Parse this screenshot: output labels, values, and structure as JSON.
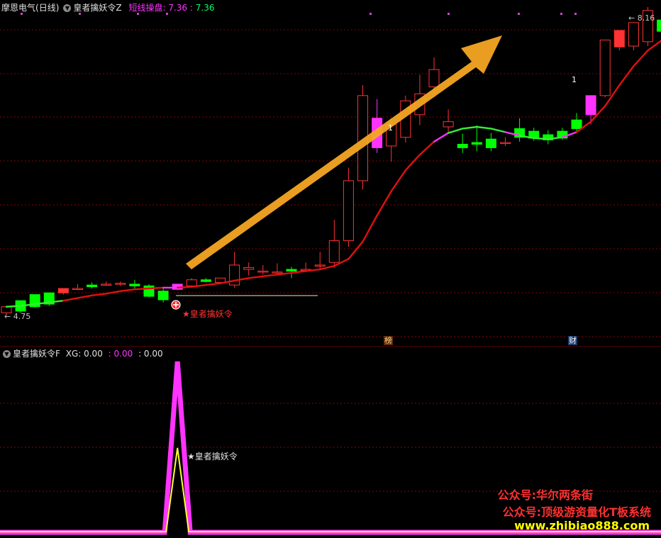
{
  "main_panel": {
    "stock_name": "摩恩电气",
    "period": "(日线)",
    "indicator_name": "皇者擒妖令Z",
    "line_label": "短线操盘",
    "line_value": "7.36",
    "line_value2": "7.36",
    "price_high": "8.16",
    "price_low": "4.75",
    "signal_label": "★皇者擒妖令",
    "badge_list": "榜",
    "badge_fin": "财",
    "candle_number_1": "1",
    "candle_number_2": "1",
    "colors": {
      "up": "#ff3333",
      "down": "#00ff00",
      "grid": "#8b0000",
      "signal": "#ff33ff",
      "line": "#e01010",
      "arrow": "#f5a623"
    }
  },
  "sub_panel": {
    "indicator_name": "皇者擒妖令F",
    "xg_label": "XG: 0.00",
    "val2": ": 0.00",
    "val3": ": 0.00",
    "signal_label": "★皇者擒妖令"
  },
  "watermark": {
    "line1": "公众号:华尔两条街",
    "line2": "公众号:顶级游资量化T板系统",
    "line3": "www.zhibiao888.com"
  },
  "chart_data": {
    "type": "candlestick",
    "y_range": [
      4.75,
      8.16
    ],
    "candles": [
      {
        "o": 4.78,
        "h": 4.85,
        "c": 4.85,
        "l": 4.75
      },
      {
        "o": 4.8,
        "h": 4.92,
        "c": 4.92,
        "l": 4.78
      },
      {
        "o": 4.85,
        "h": 4.99,
        "c": 4.99,
        "l": 4.84
      },
      {
        "o": 4.88,
        "h": 5.01,
        "c": 5.01,
        "l": 4.86
      },
      {
        "o": 5.01,
        "h": 5.06,
        "c": 5.06,
        "l": 4.99
      },
      {
        "o": 5.06,
        "h": 5.11,
        "c": 5.06,
        "l": 5.04
      },
      {
        "o": 5.1,
        "h": 5.13,
        "c": 5.08,
        "l": 5.06
      },
      {
        "o": 5.11,
        "h": 5.14,
        "c": 5.11,
        "l": 5.09
      },
      {
        "o": 5.11,
        "h": 5.14,
        "c": 5.12,
        "l": 5.09
      },
      {
        "o": 5.11,
        "h": 5.16,
        "c": 5.09,
        "l": 5.05
      },
      {
        "o": 5.09,
        "h": 5.11,
        "c": 4.97,
        "l": 4.96
      },
      {
        "o": 5.03,
        "h": 5.06,
        "c": 4.93,
        "l": 4.9
      },
      {
        "o": 5.05,
        "h": 5.11,
        "c": 5.11,
        "l": 5.04
      },
      {
        "o": 5.09,
        "h": 5.18,
        "c": 5.16,
        "l": 5.07
      },
      {
        "o": 5.16,
        "h": 5.18,
        "c": 5.14,
        "l": 5.13
      },
      {
        "o": 5.13,
        "h": 5.18,
        "c": 5.18,
        "l": 5.11
      },
      {
        "o": 5.1,
        "h": 5.48,
        "c": 5.33,
        "l": 5.07
      },
      {
        "o": 5.28,
        "h": 5.36,
        "c": 5.3,
        "l": 5.21
      },
      {
        "o": 5.26,
        "h": 5.33,
        "c": 5.26,
        "l": 5.22
      },
      {
        "o": 5.25,
        "h": 5.35,
        "c": 5.25,
        "l": 5.21
      },
      {
        "o": 5.28,
        "h": 5.31,
        "c": 5.26,
        "l": 5.18
      },
      {
        "o": 5.28,
        "h": 5.36,
        "c": 5.28,
        "l": 5.25
      },
      {
        "o": 5.33,
        "h": 5.48,
        "c": 5.33,
        "l": 5.28
      },
      {
        "o": 5.36,
        "h": 5.85,
        "c": 5.61,
        "l": 5.3
      },
      {
        "o": 5.61,
        "h": 6.45,
        "c": 6.3,
        "l": 5.54
      },
      {
        "o": 6.3,
        "h": 7.4,
        "c": 7.28,
        "l": 6.2
      },
      {
        "o": 7.02,
        "h": 7.24,
        "c": 6.68,
        "l": 6.62
      },
      {
        "o": 6.7,
        "h": 7.02,
        "c": 6.95,
        "l": 6.52
      },
      {
        "o": 6.8,
        "h": 7.28,
        "c": 7.22,
        "l": 6.74
      },
      {
        "o": 7.06,
        "h": 7.52,
        "c": 7.3,
        "l": 6.94
      },
      {
        "o": 7.38,
        "h": 7.72,
        "c": 7.58,
        "l": 7.26
      },
      {
        "o": 6.92,
        "h": 7.12,
        "c": 6.98,
        "l": 6.84
      },
      {
        "o": 6.72,
        "h": 6.84,
        "c": 6.68,
        "l": 6.62
      },
      {
        "o": 6.74,
        "h": 6.94,
        "c": 6.72,
        "l": 6.64
      },
      {
        "o": 6.78,
        "h": 6.85,
        "c": 6.68,
        "l": 6.64
      },
      {
        "o": 6.74,
        "h": 6.8,
        "c": 6.74,
        "l": 6.7
      },
      {
        "o": 6.9,
        "h": 7.02,
        "c": 6.8,
        "l": 6.75
      },
      {
        "o": 6.87,
        "h": 6.91,
        "c": 6.79,
        "l": 6.76
      },
      {
        "o": 6.83,
        "h": 6.88,
        "c": 6.77,
        "l": 6.72
      },
      {
        "o": 6.87,
        "h": 6.91,
        "c": 6.79,
        "l": 6.77
      },
      {
        "o": 7.0,
        "h": 7.08,
        "c": 6.9,
        "l": 6.85
      },
      {
        "o": 7.06,
        "h": 7.28,
        "c": 7.28,
        "l": 6.95
      },
      {
        "o": 7.28,
        "h": 7.92,
        "c": 7.92,
        "l": 7.26
      },
      {
        "o": 7.84,
        "h": 8.03,
        "c": 8.03,
        "l": 7.8
      },
      {
        "o": 7.85,
        "h": 8.12,
        "c": 8.12,
        "l": 7.8
      },
      {
        "o": 7.9,
        "h": 8.3,
        "c": 8.26,
        "l": 7.85
      },
      {
        "o": 8.15,
        "h": 8.5,
        "c": 8.02,
        "l": 7.96
      },
      {
        "o": 8.08,
        "h": 8.14,
        "c": 7.98,
        "l": 7.92
      },
      {
        "o": 8.05,
        "h": 8.18,
        "c": 8.0,
        "l": 7.95
      }
    ],
    "ma": [
      4.85,
      4.86,
      4.88,
      4.9,
      4.92,
      4.95,
      4.98,
      5.0,
      5.03,
      5.05,
      5.06,
      5.07,
      5.07,
      5.08,
      5.1,
      5.12,
      5.15,
      5.18,
      5.2,
      5.22,
      5.24,
      5.26,
      5.28,
      5.32,
      5.4,
      5.6,
      5.9,
      6.18,
      6.42,
      6.6,
      6.75,
      6.85,
      6.9,
      6.92,
      6.9,
      6.86,
      6.82,
      6.79,
      6.78,
      6.8,
      6.86,
      6.98,
      7.16,
      7.4,
      7.62,
      7.8,
      7.92,
      7.98,
      8.02
    ],
    "signal_index": 12,
    "sub_series": [
      0,
      0,
      0,
      0,
      0,
      0,
      0,
      0,
      0,
      0,
      0,
      0,
      1,
      0,
      0,
      0,
      0,
      0,
      0,
      0,
      0,
      0,
      0,
      0,
      0,
      0,
      0,
      0,
      0,
      0,
      0,
      0,
      0,
      0,
      0,
      0,
      0,
      0,
      0,
      0,
      0,
      0,
      0,
      0,
      0,
      0,
      0,
      0,
      0
    ]
  }
}
